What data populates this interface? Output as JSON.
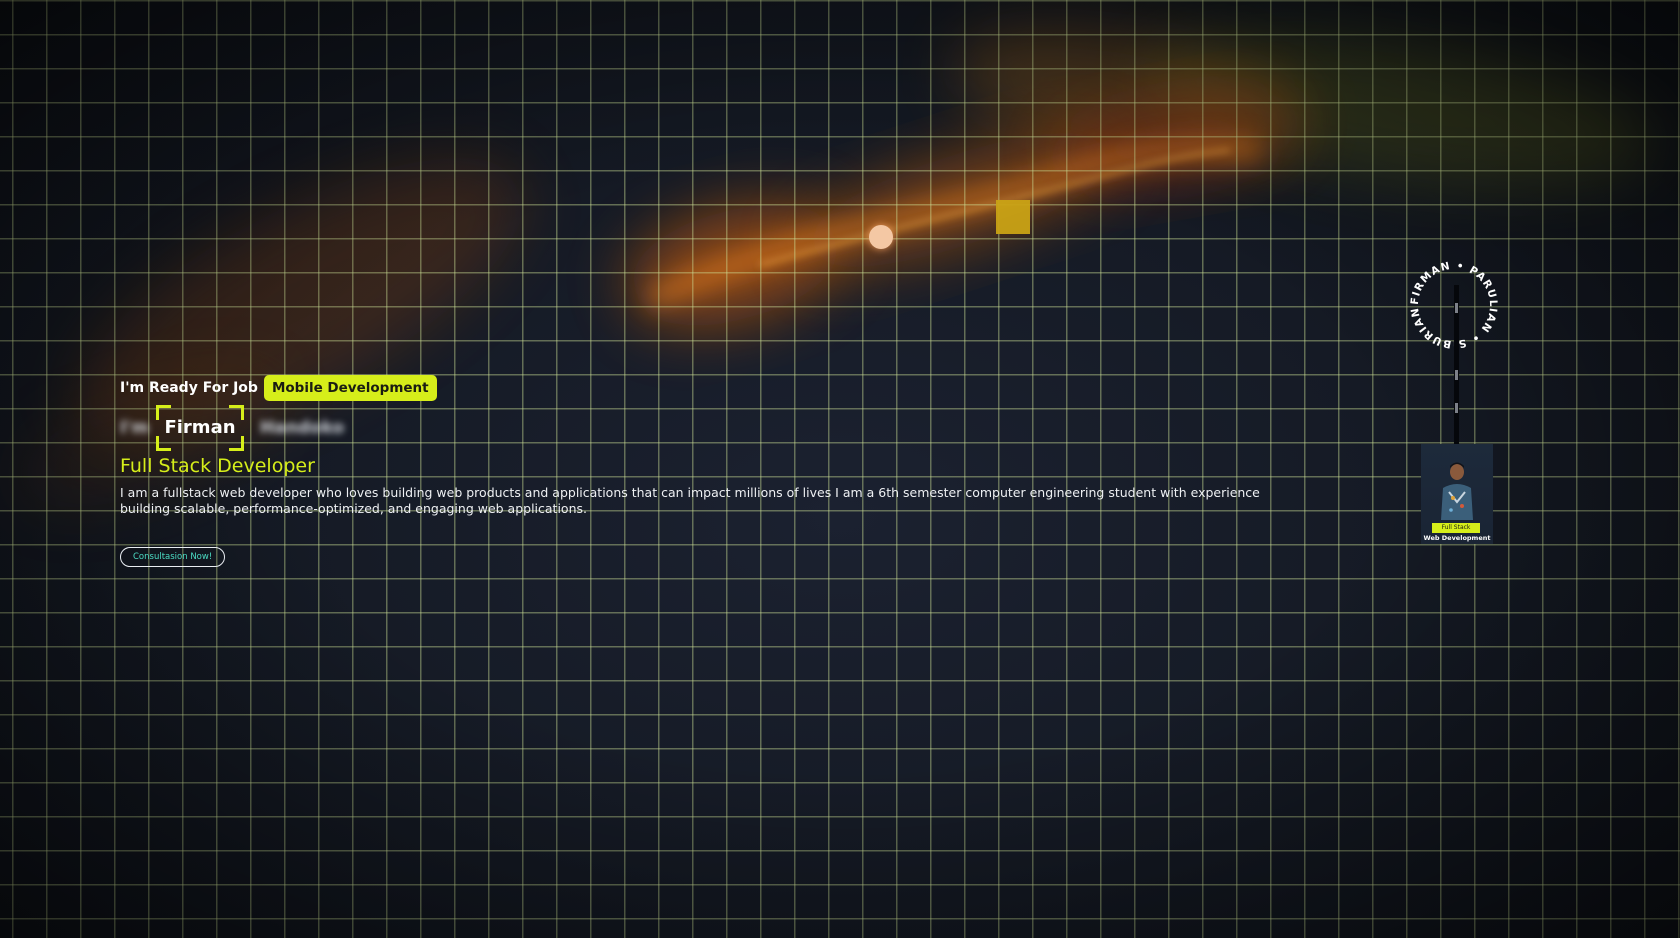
{
  "hero": {
    "ready_text": "I'm Ready For Job",
    "ready_badge": "Mobile Development",
    "name_left_blurred": "I'm",
    "name": "Firman",
    "name_right_blurred": "Handoko",
    "role": "Full Stack Developer",
    "description": "I am a fullstack web developer who loves building web products and applications that can impact millions of lives I am a 6th semester computer engineering student with experience building scalable, performance-optimized, and engaging web applications.",
    "cta_label": "Consultasion Now!"
  },
  "badge": {
    "ring_text": "FIRMAN • PARULIAN • SIBURIAN •",
    "card_tag": "Full Stack",
    "card_subtitle": "Web Development"
  },
  "colors": {
    "accent": "#d6ee1a",
    "background": "#151a24",
    "grid": "#cde196",
    "cta_text": "#4bdcc4"
  }
}
